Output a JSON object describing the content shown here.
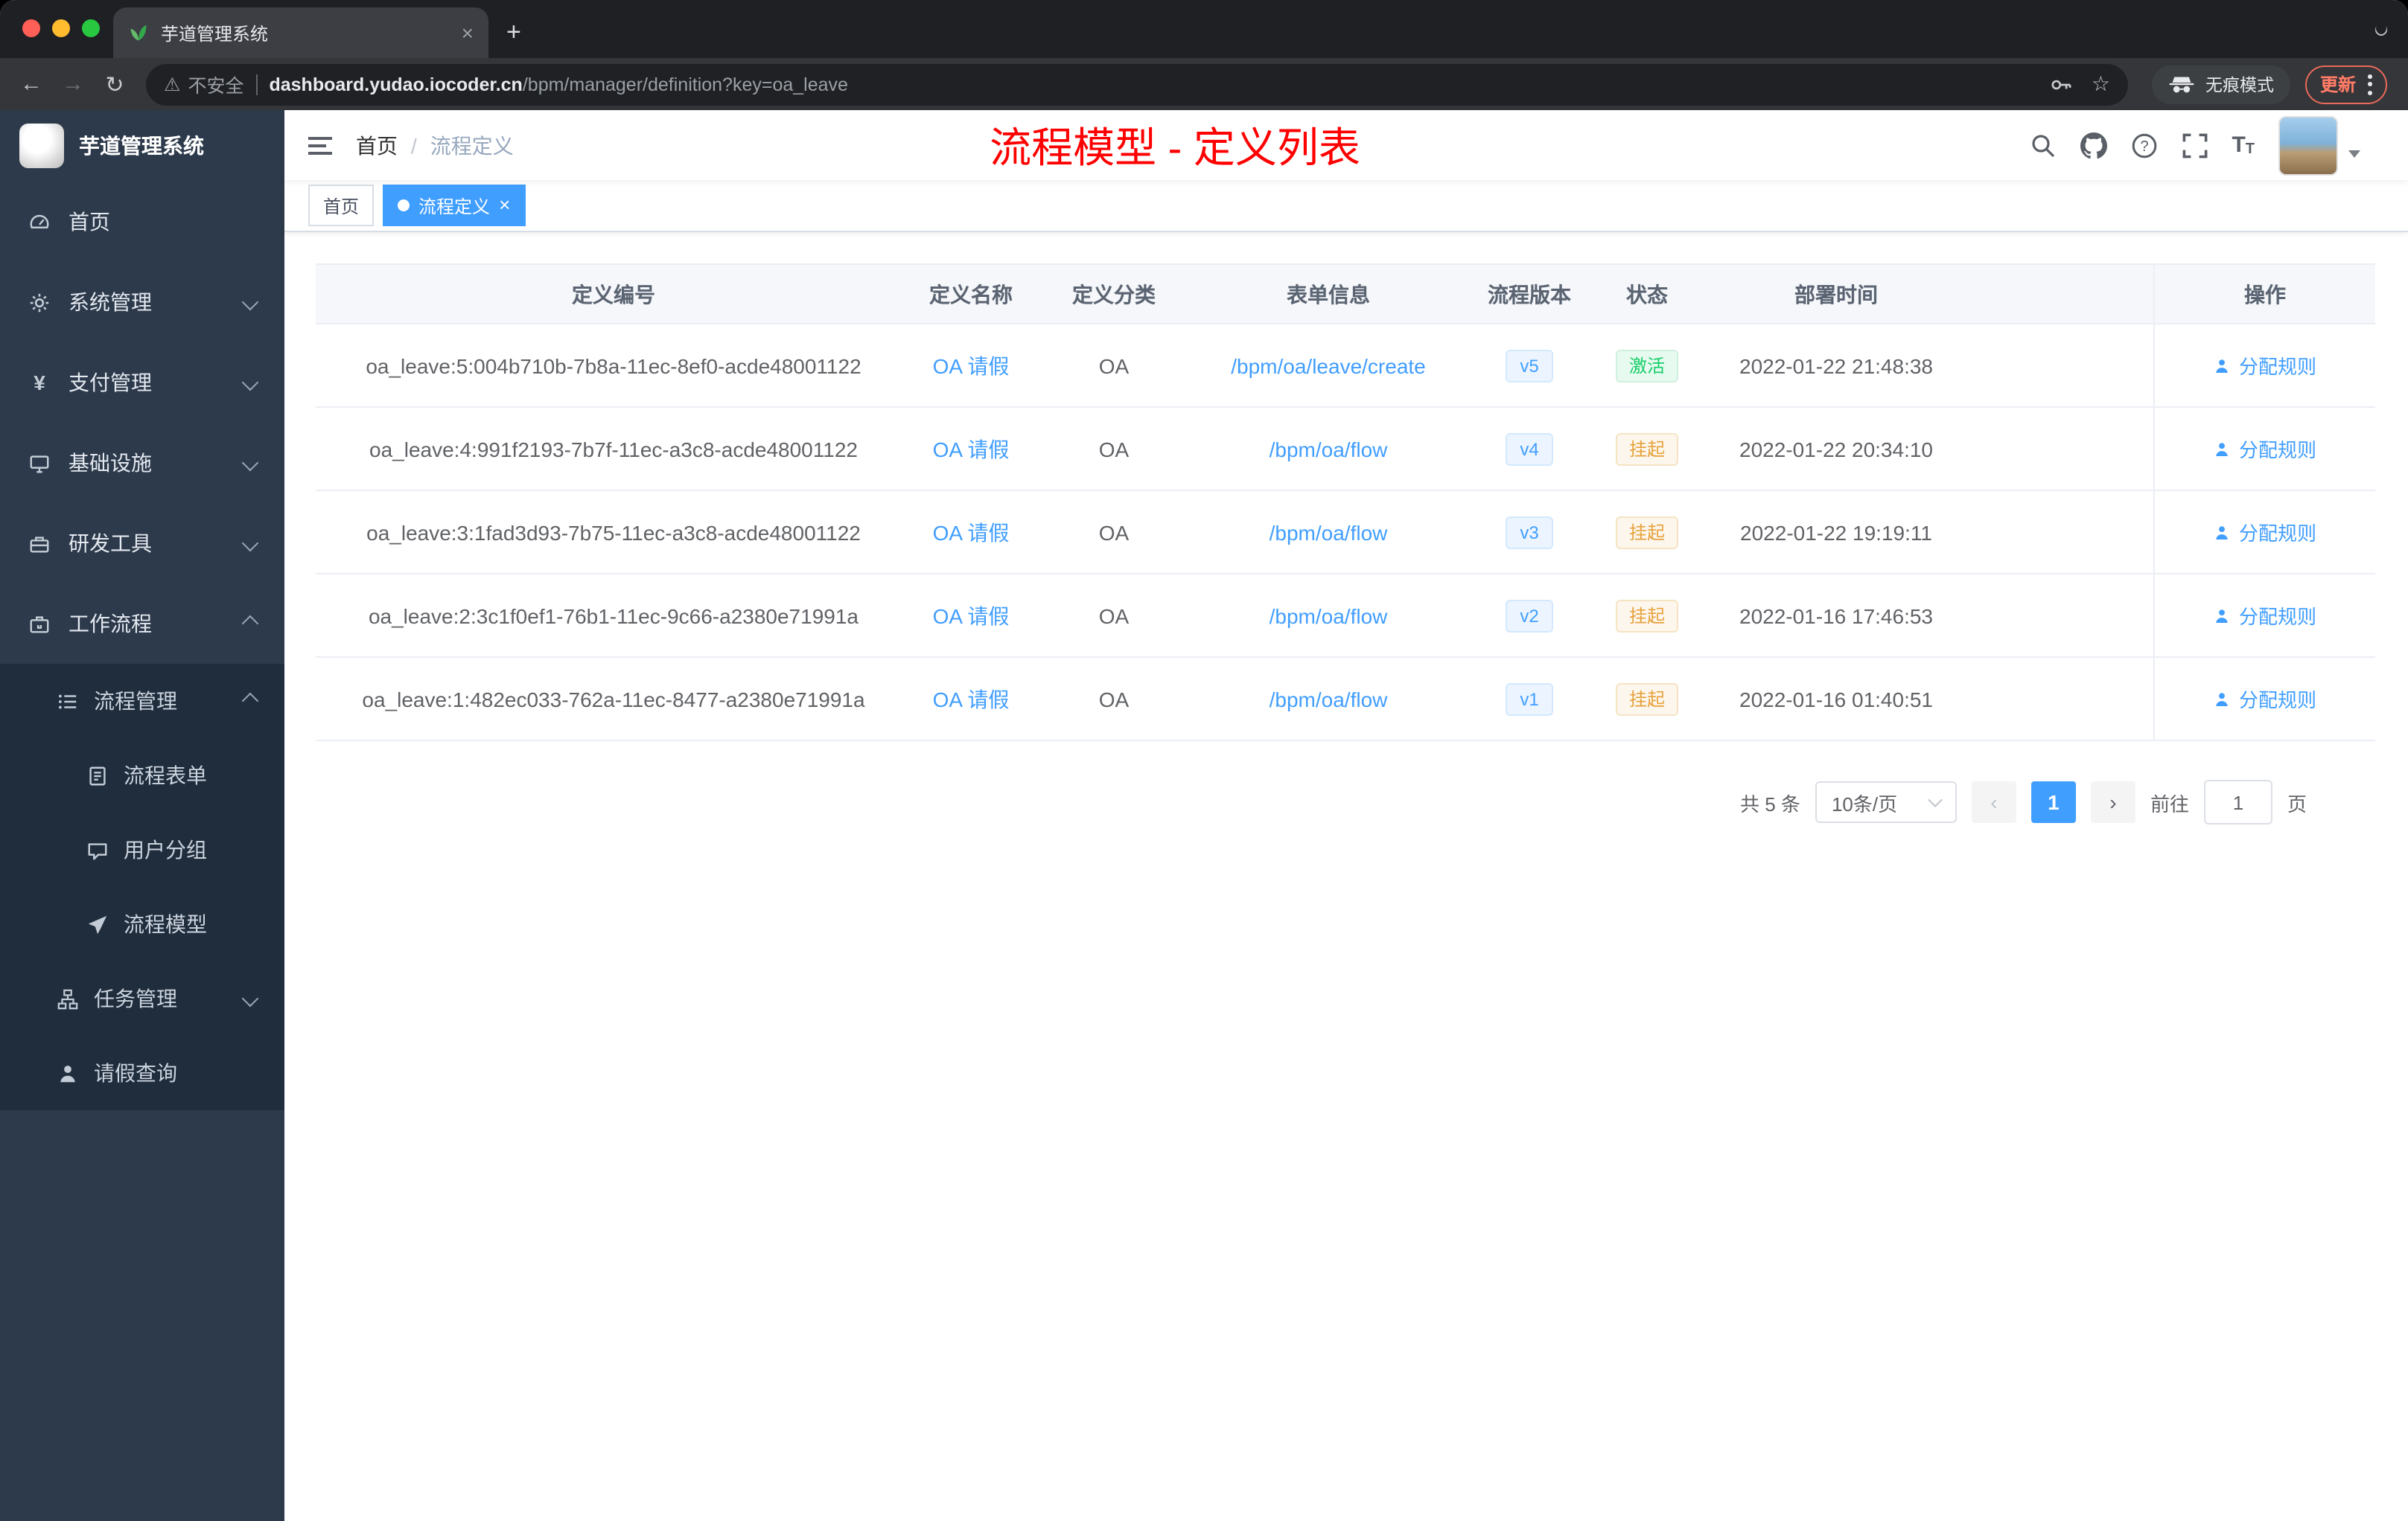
{
  "browser": {
    "tab_title": "芋道管理系统",
    "security_label": "不安全",
    "url_host": "dashboard.yudao.iocoder.cn",
    "url_path": "/bpm/manager/definition?key=oa_leave",
    "incognito_label": "无痕模式",
    "update_label": "更新"
  },
  "glyphs": {
    "back": "←",
    "forward": "→",
    "reload": "↻",
    "warning": "⚠",
    "star": "☆",
    "close": "×",
    "plus": "+",
    "prev": "‹",
    "next": "›",
    "yen": "¥",
    "question": "?",
    "font_big": "T",
    "font_small": "T"
  },
  "sidebar": {
    "logo_title": "芋道管理系统",
    "items": [
      {
        "label": "首页"
      },
      {
        "label": "系统管理"
      },
      {
        "label": "支付管理"
      },
      {
        "label": "基础设施"
      },
      {
        "label": "研发工具"
      },
      {
        "label": "工作流程"
      },
      {
        "label": "流程管理"
      },
      {
        "label": "流程表单"
      },
      {
        "label": "用户分组"
      },
      {
        "label": "流程模型"
      },
      {
        "label": "任务管理"
      },
      {
        "label": "请假查询"
      }
    ]
  },
  "header": {
    "breadcrumb": {
      "home": "首页",
      "separator": "/",
      "current": "流程定义"
    },
    "title": "流程模型 - 定义列表"
  },
  "tags": {
    "items": [
      {
        "label": "首页",
        "active": false
      },
      {
        "label": "流程定义",
        "active": true
      }
    ]
  },
  "table": {
    "columns": [
      "定义编号",
      "定义名称",
      "定义分类",
      "表单信息",
      "流程版本",
      "状态",
      "部署时间",
      "操作"
    ],
    "rows": [
      {
        "id": "oa_leave:5:004b710b-7b8a-11ec-8ef0-acde48001122",
        "name": "OA 请假",
        "category": "OA",
        "form": "/bpm/oa/leave/create",
        "version": "v5",
        "status": "激活",
        "status_type": "success",
        "deploy_time": "2022-01-22 21:48:38",
        "action": "分配规则"
      },
      {
        "id": "oa_leave:4:991f2193-7b7f-11ec-a3c8-acde48001122",
        "name": "OA 请假",
        "category": "OA",
        "form": "/bpm/oa/flow",
        "version": "v4",
        "status": "挂起",
        "status_type": "warning",
        "deploy_time": "2022-01-22 20:34:10",
        "action": "分配规则"
      },
      {
        "id": "oa_leave:3:1fad3d93-7b75-11ec-a3c8-acde48001122",
        "name": "OA 请假",
        "category": "OA",
        "form": "/bpm/oa/flow",
        "version": "v3",
        "status": "挂起",
        "status_type": "warning",
        "deploy_time": "2022-01-22 19:19:11",
        "action": "分配规则"
      },
      {
        "id": "oa_leave:2:3c1f0ef1-76b1-11ec-9c66-a2380e71991a",
        "name": "OA 请假",
        "category": "OA",
        "form": "/bpm/oa/flow",
        "version": "v2",
        "status": "挂起",
        "status_type": "warning",
        "deploy_time": "2022-01-16 17:46:53",
        "action": "分配规则"
      },
      {
        "id": "oa_leave:1:482ec033-762a-11ec-8477-a2380e71991a",
        "name": "OA 请假",
        "category": "OA",
        "form": "/bpm/oa/flow",
        "version": "v1",
        "status": "挂起",
        "status_type": "warning",
        "deploy_time": "2022-01-16 01:40:51",
        "action": "分配规则"
      }
    ]
  },
  "pagination": {
    "total": "共 5 条",
    "page_size": "10条/页",
    "current_page": "1",
    "goto_label": "前往",
    "goto_value": "1",
    "page_suffix": "页"
  },
  "colors": {
    "accent_blue": "#409eff",
    "success_green": "#13ce66",
    "warning_orange": "#e6a23c",
    "title_red": "#fe0000",
    "sidebar_bg": "#2d3a4b",
    "submenu_bg": "#1f2d3d"
  }
}
